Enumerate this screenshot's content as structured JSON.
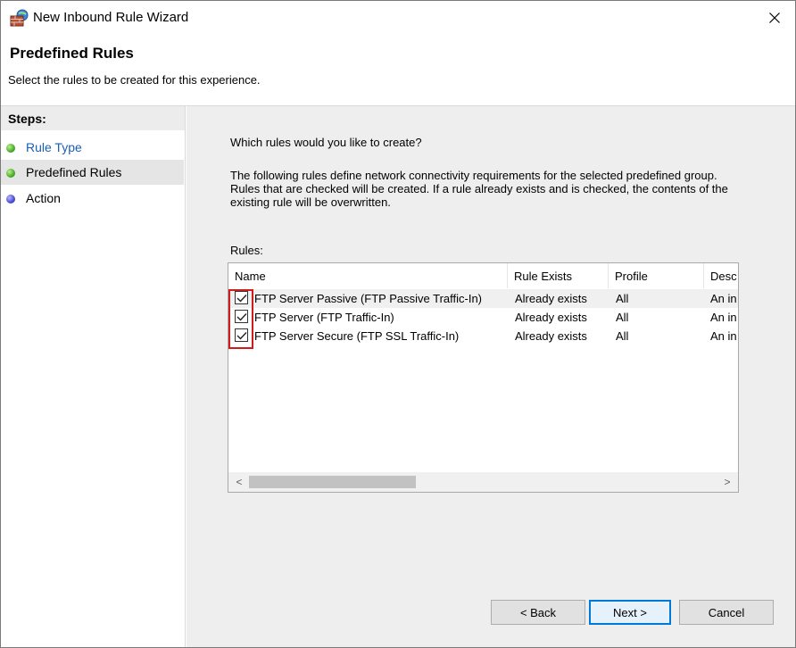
{
  "window": {
    "title": "New Inbound Rule Wizard",
    "close_glyph": "✕"
  },
  "header": {
    "title": "Predefined Rules",
    "subtitle": "Select the rules to be created for this experience."
  },
  "steps": {
    "title": "Steps:",
    "items": [
      {
        "label": "Rule Type",
        "state": "link",
        "dot": "green"
      },
      {
        "label": "Predefined Rules",
        "state": "current",
        "dot": "green"
      },
      {
        "label": "Action",
        "state": "pending",
        "dot": "blue"
      }
    ]
  },
  "content": {
    "question": "Which rules would you like to create?",
    "description": "The following rules define network connectivity requirements for the selected predefined group. Rules that are checked will be created. If a rule already exists and is checked, the contents of the existing rule will be overwritten.",
    "rules_label": "Rules:"
  },
  "table": {
    "columns": [
      "Name",
      "Rule Exists",
      "Profile",
      "Desc"
    ],
    "rows": [
      {
        "checked": true,
        "name": "FTP Server Passive (FTP Passive Traffic-In)",
        "exists": "Already exists",
        "profile": "All",
        "desc": "An in"
      },
      {
        "checked": true,
        "name": "FTP Server (FTP Traffic-In)",
        "exists": "Already exists",
        "profile": "All",
        "desc": "An in"
      },
      {
        "checked": true,
        "name": "FTP Server Secure (FTP SSL Traffic-In)",
        "exists": "Already exists",
        "profile": "All",
        "desc": "An in"
      }
    ],
    "scroll_left": "<",
    "scroll_right": ">"
  },
  "buttons": {
    "back": "< Back",
    "next": "Next >",
    "cancel": "Cancel"
  },
  "colors": {
    "highlight_box": "#d01c1c",
    "link": "#1a5fb4",
    "default_button_border": "#0078d7"
  },
  "icons": {
    "app": "firewall-brick-globe-icon",
    "check": "checkmark-icon",
    "close": "close-icon"
  }
}
